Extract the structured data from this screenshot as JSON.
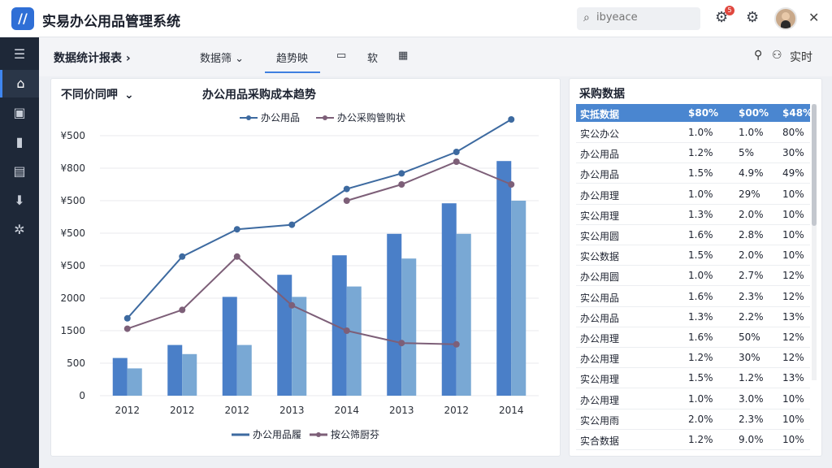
{
  "app": {
    "title": "实易办公用品管理系统",
    "logo": "logo-icon"
  },
  "search": {
    "placeholder": "ibyeace"
  },
  "topbar": {
    "notification_count": "5"
  },
  "breadcrumb": "数据统计报表",
  "tabs": [
    {
      "label": "数据筛"
    },
    {
      "label": "趋势映"
    },
    {
      "label": "软"
    }
  ],
  "subbar_right": {
    "label": "实时"
  },
  "chart_card": {
    "dropdown_label": "不同价同呷"
  },
  "chart_data": {
    "type": "bar+line",
    "title": "办公用品采购成本趋势",
    "categories": [
      "2012",
      "2012",
      "2012",
      "2013",
      "2014",
      "2013",
      "2012",
      "2014"
    ],
    "y_tick_labels": [
      "0",
      "500",
      "1500",
      "2000",
      "¥500",
      "¥500",
      "¥500",
      "¥800",
      "¥500"
    ],
    "ylim": [
      0,
      4000
    ],
    "bar_series": [
      {
        "values": [
          580,
          780,
          1520,
          1860,
          2160,
          2490,
          2960,
          3610
        ]
      },
      {
        "values": [
          420,
          640,
          780,
          1520,
          1680,
          2110,
          2490,
          3000
        ]
      }
    ],
    "line_series": [
      {
        "name": "办公用品",
        "values": [
          1190,
          2140,
          2560,
          2630,
          3180,
          3420,
          3750,
          4250
        ]
      },
      {
        "name": "办公采购管购状",
        "values": [
          1030,
          1320,
          2140,
          1390,
          1000,
          810,
          790,
          null
        ]
      }
    ],
    "line_series_extra": {
      "name": "办公采购管购状",
      "values": [
        null,
        null,
        null,
        null,
        3000,
        3250,
        3600,
        3250
      ]
    },
    "legend_top": [
      "办公用品",
      "办公采购管购状"
    ],
    "legend_bottom": [
      "办公用品履",
      "按公筛厨芬"
    ],
    "colors": {
      "bar1": "#4a7fc8",
      "bar2": "#79a8d4",
      "line1": "#3d6aa0",
      "line2": "#7d5f78"
    }
  },
  "data_panel": {
    "title": "采购数据",
    "header": [
      "实抵数据",
      "$80%",
      "$00%",
      "$48%"
    ],
    "rows": [
      [
        "实公办公",
        "1.0%",
        "1.0%",
        "80%"
      ],
      [
        "办公用品",
        "1.2%",
        "5%",
        "30%"
      ],
      [
        "办公用品",
        "1.5%",
        "4.9%",
        "49%"
      ],
      [
        "办公用理",
        "1.0%",
        "29%",
        "10%"
      ],
      [
        "实公用理",
        "1.3%",
        "2.0%",
        "10%"
      ],
      [
        "实公用圆",
        "1.6%",
        "2.8%",
        "10%"
      ],
      [
        "实公数据",
        "1.5%",
        "2.0%",
        "10%"
      ],
      [
        "办公用圆",
        "1.0%",
        "2.7%",
        "12%"
      ],
      [
        "实公用品",
        "1.6%",
        "2.3%",
        "12%"
      ],
      [
        "办公用品",
        "1.3%",
        "2.2%",
        "13%"
      ],
      [
        "办公用理",
        "1.6%",
        "50%",
        "12%"
      ],
      [
        "办公用理",
        "1.2%",
        "30%",
        "12%"
      ],
      [
        "实公用理",
        "1.5%",
        "1.2%",
        "13%"
      ],
      [
        "办公用理",
        "1.0%",
        "3.0%",
        "10%"
      ],
      [
        "实公用雨",
        "2.0%",
        "2.3%",
        "10%"
      ],
      [
        "实合数据",
        "1.2%",
        "9.0%",
        "10%"
      ]
    ]
  }
}
